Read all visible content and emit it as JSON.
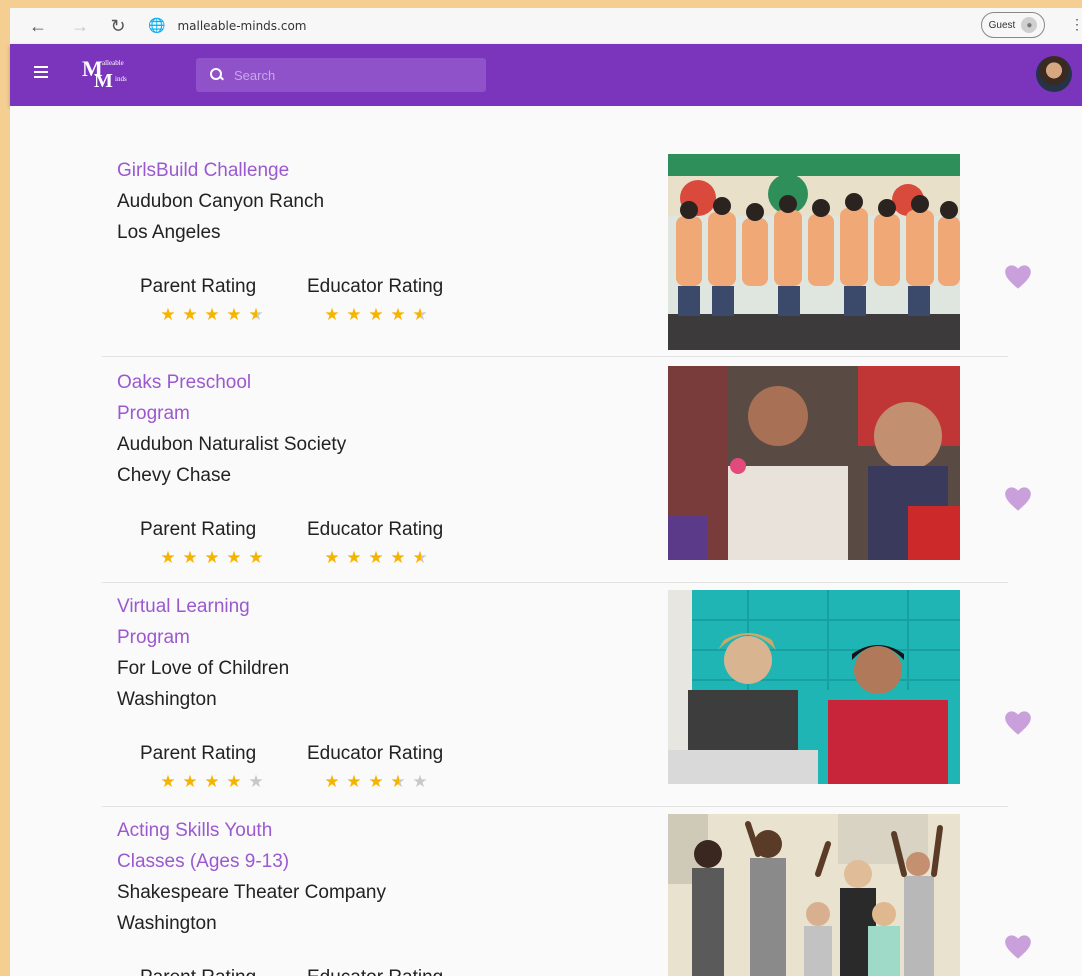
{
  "browser": {
    "url": "malleable-minds.com",
    "profile_label": "Guest"
  },
  "header": {
    "logo_top_text": "alleable",
    "logo_bottom_text": "inds",
    "search_placeholder": "Search",
    "brand_color": "#7b35bd"
  },
  "labels": {
    "parent_rating": "Parent Rating",
    "educator_rating": "Educator Rating"
  },
  "programs": [
    {
      "title": "GirlsBuild Challenge",
      "organization": "Audubon Canyon Ranch",
      "city": "Los Angeles",
      "parent_rating": 4.5,
      "educator_rating": 4.5,
      "favorite_icon": "heart-icon",
      "photo": "group of girls in orange t-shirts"
    },
    {
      "title": "Oaks Preschool Program",
      "organization": "Audubon Naturalist Society",
      "city": "Chevy Chase",
      "parent_rating": 5,
      "educator_rating": 4.5,
      "favorite_icon": "heart-icon",
      "photo": "children doing crafts"
    },
    {
      "title": "Virtual Learning Program",
      "organization": "For Love of Children",
      "city": "Washington",
      "parent_rating": 4,
      "educator_rating": 3.5,
      "favorite_icon": "heart-icon",
      "photo": "two girls at a table"
    },
    {
      "title": "Acting Skills Youth Classes (Ages 9-13)",
      "organization": "Shakespeare Theater Company",
      "city": "Washington",
      "parent_rating": null,
      "educator_rating": null,
      "favorite_icon": "heart-icon",
      "photo": "kids with raised arms"
    }
  ],
  "colors": {
    "accent_purple": "#9b59d0",
    "heart": "#c9a0dc",
    "star_filled": "#f5b400",
    "star_empty": "#c8c8c8"
  }
}
